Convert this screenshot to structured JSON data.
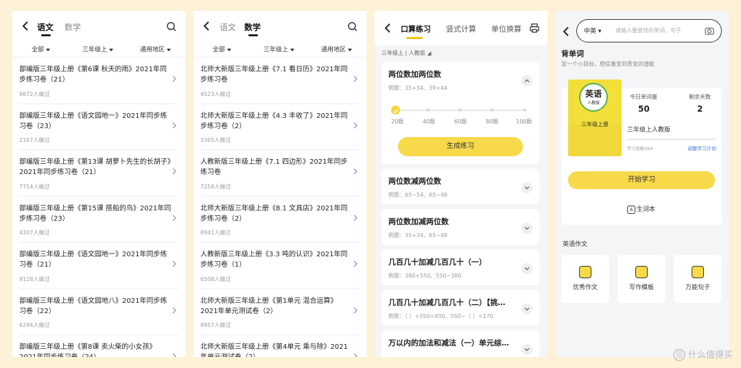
{
  "panel1": {
    "tabs": [
      "语文",
      "数学"
    ],
    "filters": [
      "全部",
      "三年级上",
      "通用地区"
    ],
    "items": [
      {
        "title": "部编版三年级上册《第6课 秋天的雨》2021年同步练习卷（21）",
        "count": "9672人做过"
      },
      {
        "title": "部编版三年级上册《语文园地一》2021年同步练习卷（23）",
        "count": "2167人做过"
      },
      {
        "title": "部编版三年级上册《第13课 胡萝卜先生的长胡子》2021年同步练习卷（21）",
        "count": "7714人做过"
      },
      {
        "title": "部编版三年级上册《第15课 搭船的鸟》2021年同步练习卷（23）",
        "count": "4307人做过"
      },
      {
        "title": "部编版三年级上册《语文园地一》2021年同步练习卷（21）",
        "count": "9128人做过"
      },
      {
        "title": "部编版三年级上册《语文园地八》2021年同步练习卷（22）",
        "count": "6294人做过"
      },
      {
        "title": "部编版三年级上册《第8课 卖火柴的小女孩》2021年同步练习卷（24）",
        "count": ""
      }
    ]
  },
  "panel2": {
    "tabs": [
      "语文",
      "数学"
    ],
    "filters": [
      "全部",
      "三年级上",
      "通用地区"
    ],
    "items": [
      {
        "title": "北师大新版三年级上册《7.1 看日历》2021年同步练习卷",
        "count": "4523人做过"
      },
      {
        "title": "北师大新版三年级上册《4.3 丰收了》2021年同步练习卷（2）",
        "count": "3365人做过"
      },
      {
        "title": "人教新版三年级上册《7.1 四边形》2021年同步练习卷",
        "count": "7258人做过"
      },
      {
        "title": "北师大新版三年级上册《8.1 文具店》2021年同步练习卷（2）",
        "count": "8941人做过"
      },
      {
        "title": "人教新版三年级上册《3.3 吨的认识》2021年同步练习卷（1）",
        "count": "6508人做过"
      },
      {
        "title": "北师大新版三年级上册《第1单元 混合运算》2021年单元测试卷（2）",
        "count": "8957人做过"
      },
      {
        "title": "北师大新版三年级上册《第4单元 乘与除》2021年单元测试卷（2）",
        "count": ""
      }
    ]
  },
  "panel3": {
    "tabs": [
      "口算练习",
      "竖式计算",
      "单位换算"
    ],
    "grade": "三年级上 | 人教版",
    "cards": [
      {
        "title": "两位数加两位数",
        "example": "例题：35+34、39+44"
      },
      {
        "title": "两位数减两位数",
        "example": "例题：65−54、65−48"
      },
      {
        "title": "两位数加减两位数",
        "example": "例题：35+34、65−48"
      },
      {
        "title": "几百几十加减几百几十（一）",
        "example": "例题：380+550、550−380"
      },
      {
        "title": "几百几十加减几百几十（二）【挑…",
        "example": "例题：（ ）+550=930、550−（ ）=170"
      },
      {
        "title": "万以内的加法和减法（一）单元综…",
        "example": ""
      }
    ],
    "slider_labels": [
      "20题",
      "40题",
      "60题",
      "80题",
      "100题"
    ],
    "slider_selected": 0,
    "generate_label": "生成练习"
  },
  "panel4": {
    "lang": "中英",
    "search_placeholder": "请输入要查找的单词、句子",
    "title": "背单词",
    "subtitle": "定一个小目标，相信量变到质变的潜能",
    "book": {
      "subject": "英语",
      "publisher": "人教版",
      "grade": "三年级上册"
    },
    "stats": [
      {
        "label": "今日单词量",
        "value": "50"
      },
      {
        "label": "剩余天数",
        "value": "2"
      }
    ],
    "book_name": "三年级上人教版",
    "progress_label": "学习进度0/64",
    "progress": 0,
    "plan_link": "调整学习计划",
    "start_label": "开始学习",
    "vocab_icon": "A",
    "vocab_label": "生词本",
    "composition_title": "英语作文",
    "composition_items": [
      "优秀作文",
      "写作模板",
      "万能句子"
    ]
  },
  "watermark": {
    "icon": "值",
    "text": "什么值得买"
  }
}
